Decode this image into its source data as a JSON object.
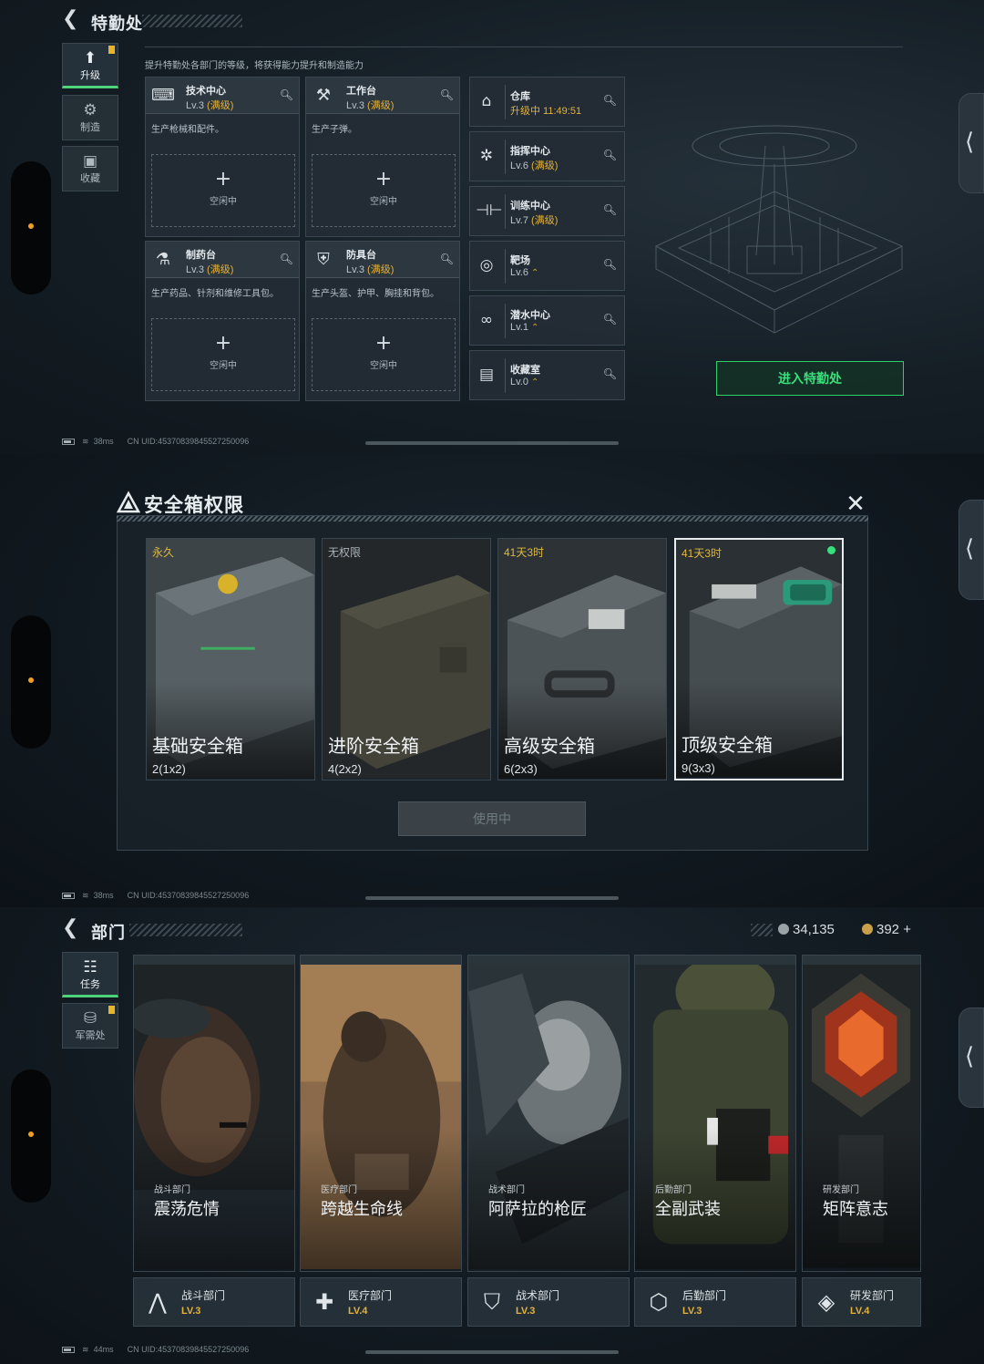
{
  "panel_upgrade": {
    "title": "特勤处",
    "description": "提升特勤处各部门的等级，将获得能力提升和制造能力",
    "tabs": [
      {
        "label": "升级",
        "icon": "upgrade-icon"
      },
      {
        "label": "制造",
        "icon": "craft-icon"
      },
      {
        "label": "收藏",
        "icon": "collection-icon"
      }
    ],
    "facilities": [
      {
        "name": "技术中心",
        "level": "Lv.3",
        "max": "(满级)",
        "desc": "生产枪械和配件。",
        "slot": "空闲中"
      },
      {
        "name": "工作台",
        "level": "Lv.3",
        "max": "(满级)",
        "desc": "生产子弹。",
        "slot": "空闲中"
      },
      {
        "name": "制药台",
        "level": "Lv.3",
        "max": "(满级)",
        "desc": "生产药品、针剂和维修工具包。",
        "slot": "空闲中"
      },
      {
        "name": "防具台",
        "level": "Lv.3",
        "max": "(满级)",
        "desc": "生产头盔、护甲、胸挂和背包。",
        "slot": "空闲中"
      }
    ],
    "buildings": [
      {
        "name": "仓库",
        "status": "升级中 11:49:51"
      },
      {
        "name": "指挥中心",
        "level": "Lv.6",
        "max": "(满级)"
      },
      {
        "name": "训练中心",
        "level": "Lv.7",
        "max": "(满级)"
      },
      {
        "name": "靶场",
        "level": "Lv.6",
        "upgrade": "⌃"
      },
      {
        "name": "潜水中心",
        "level": "Lv.1",
        "upgrade": "⌃"
      },
      {
        "name": "收藏室",
        "level": "Lv.0",
        "upgrade": "⌃"
      }
    ],
    "enter_button": "进入特勤处",
    "status": {
      "ping": "38ms",
      "uid": "CN UID:4537083984552725009​6"
    }
  },
  "panel_safebox": {
    "title": "安全箱权限",
    "boxes": [
      {
        "duration": "永久",
        "name": "基础安全箱",
        "size": "2(1x2)"
      },
      {
        "duration": "无权限",
        "name": "进阶安全箱",
        "size": "4(2x2)"
      },
      {
        "duration": "41天3时",
        "name": "高级安全箱",
        "size": "6(2x3)"
      },
      {
        "duration": "41天3时",
        "name": "顶级安全箱",
        "size": "9(3x3)"
      }
    ],
    "button": "使用中",
    "status": {
      "ping": "38ms",
      "uid": "CN UID:4537083984552725009​6"
    }
  },
  "panel_departments": {
    "title": "部门",
    "currency": {
      "coins": "34,135",
      "tokens": "392"
    },
    "tabs": [
      {
        "label": "任务",
        "icon": "task-icon"
      },
      {
        "label": "军需处",
        "icon": "supply-icon"
      }
    ],
    "departments": [
      {
        "category": "战斗部门",
        "name": "震荡危情",
        "card_name": "战斗部门",
        "level": "LV.3"
      },
      {
        "category": "医疗部门",
        "name": "跨越生命线",
        "card_name": "医疗部门",
        "level": "LV.4"
      },
      {
        "category": "战术部门",
        "name": "阿萨拉的枪匠",
        "card_name": "战术部门",
        "level": "LV.3"
      },
      {
        "category": "后勤部门",
        "name": "全副武装",
        "card_name": "后勤部门",
        "level": "LV.3"
      },
      {
        "category": "研发部门",
        "name": "矩阵意志",
        "card_name": "研发部门",
        "level": "LV.4"
      }
    ],
    "status": {
      "ping": "44ms",
      "uid": "CN UID:4537083984552725009​6"
    }
  },
  "colors": {
    "accent_green": "#38e07a",
    "max_level": "#e3b23a",
    "background": "#0e151b"
  }
}
